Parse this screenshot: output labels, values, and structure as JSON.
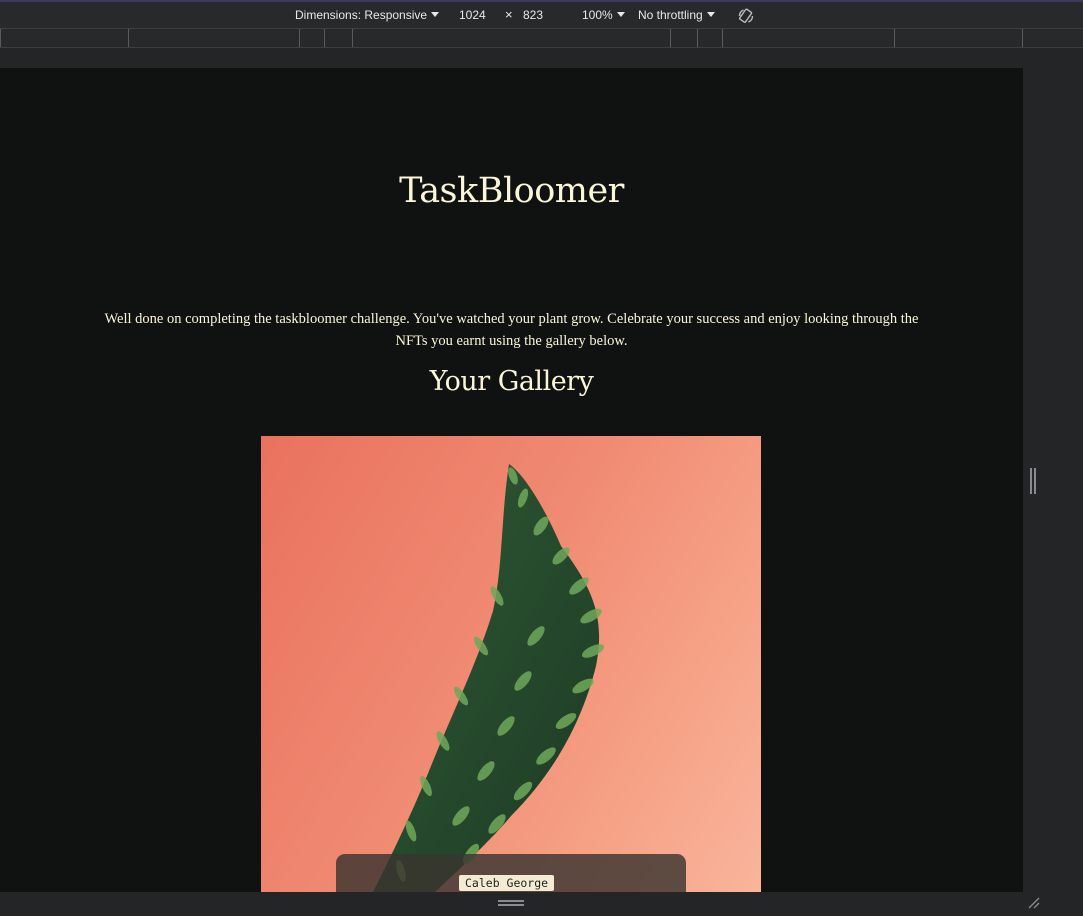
{
  "devtools": {
    "dimensions_label": "Dimensions: Responsive",
    "width_value": "1024",
    "times_symbol": "×",
    "height_value": "823",
    "zoom_label": "100%",
    "throttling_label": "No throttling"
  },
  "page": {
    "title": "TaskBloomer",
    "intro": "Well done on completing the taskbloomer challenge. You've watched your plant grow. Celebrate your success and enjoy looking through the NFTs you earnt using the gallery below.",
    "gallery_heading": "Your Gallery",
    "gallery": {
      "items": [
        {
          "artist": "Caleb George"
        }
      ]
    }
  },
  "colors": {
    "page_background": "#101211",
    "text_cream": "#fbf5d9",
    "nft_background": "#f08a72"
  }
}
